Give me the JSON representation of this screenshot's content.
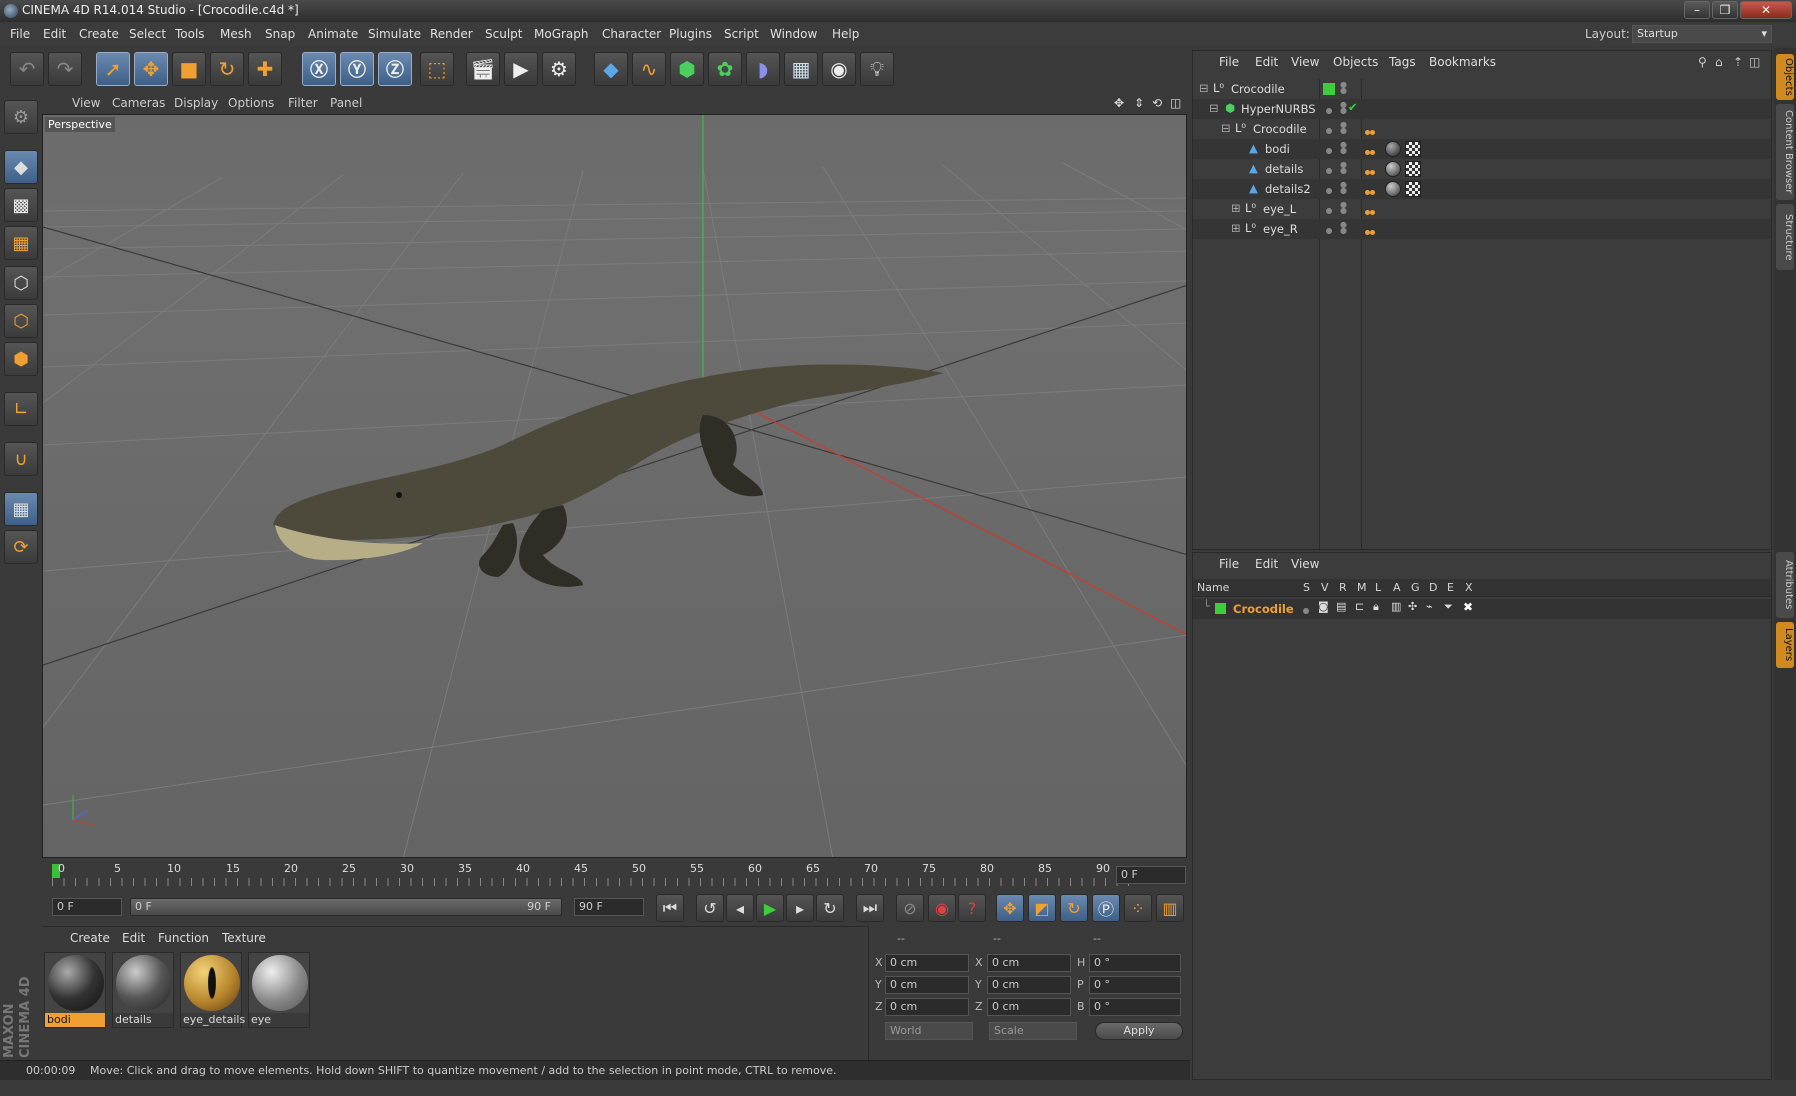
{
  "window": {
    "title": "CINEMA 4D R14.014 Studio - [Crocodile.c4d *]",
    "layout_label": "Layout:",
    "layout_value": "Startup"
  },
  "menu": [
    "File",
    "Edit",
    "Create",
    "Select",
    "Tools",
    "Mesh",
    "Snap",
    "Animate",
    "Simulate",
    "Render",
    "Sculpt",
    "MoGraph",
    "Character",
    "Plugins",
    "Script",
    "Window",
    "Help"
  ],
  "viewport": {
    "menu": [
      "View",
      "Cameras",
      "Display",
      "Options",
      "Filter",
      "Panel"
    ],
    "label": "Perspective"
  },
  "timeline": {
    "ticks": [
      "0",
      "5",
      "10",
      "15",
      "20",
      "25",
      "30",
      "35",
      "40",
      "45",
      "50",
      "55",
      "60",
      "65",
      "70",
      "75",
      "80",
      "85",
      "90"
    ],
    "current_frame": "0 F"
  },
  "transport": {
    "start": "0 F",
    "slider_start": "0 F",
    "slider_end": "90 F",
    "end": "90 F"
  },
  "materials": {
    "menu": [
      "Create",
      "Edit",
      "Function",
      "Texture"
    ],
    "items": [
      {
        "name": "bodi",
        "selected": true
      },
      {
        "name": "details",
        "selected": false
      },
      {
        "name": "eye_details",
        "selected": false
      },
      {
        "name": "eye",
        "selected": false
      }
    ]
  },
  "coords": {
    "headers": [
      "--",
      "--",
      "--"
    ],
    "rows": [
      {
        "a": "X",
        "av": "0 cm",
        "b": "X",
        "bv": "0 cm",
        "c": "H",
        "cv": "0 °"
      },
      {
        "a": "Y",
        "av": "0 cm",
        "b": "Y",
        "bv": "0 cm",
        "c": "P",
        "cv": "0 °"
      },
      {
        "a": "Z",
        "av": "0 cm",
        "b": "Z",
        "bv": "0 cm",
        "c": "B",
        "cv": "0 °"
      }
    ],
    "space": "World",
    "mode": "Scale",
    "apply": "Apply"
  },
  "status": {
    "time": "00:00:09",
    "message": "Move: Click and drag to move elements. Hold down SHIFT to quantize movement / add to the selection in point mode, CTRL to remove."
  },
  "objects": {
    "menu": [
      "File",
      "Edit",
      "View",
      "Objects",
      "Tags",
      "Bookmarks"
    ],
    "items": [
      {
        "name": "Crocodile",
        "indent": 0
      },
      {
        "name": "HyperNURBS",
        "indent": 1
      },
      {
        "name": "Crocodile",
        "indent": 2
      },
      {
        "name": "bodi",
        "indent": 3
      },
      {
        "name": "details",
        "indent": 3
      },
      {
        "name": "details2",
        "indent": 3
      },
      {
        "name": "eye_L",
        "indent": 2
      },
      {
        "name": "eye_R",
        "indent": 2
      }
    ]
  },
  "layers": {
    "menu": [
      "File",
      "Edit",
      "View"
    ],
    "columns": [
      "Name",
      "S",
      "V",
      "R",
      "M",
      "L",
      "A",
      "G",
      "D",
      "E",
      "X"
    ],
    "rows": [
      {
        "name": "Crocodile"
      }
    ]
  },
  "right_tabs": [
    "Objects",
    "Content Browser",
    "Structure",
    "Attributes",
    "Layers"
  ],
  "brand": "MAXON CINEMA 4D",
  "colors": {
    "accent": "#f0a030",
    "selection": "#3e5f86",
    "layer_green": "#3ccf3c"
  }
}
